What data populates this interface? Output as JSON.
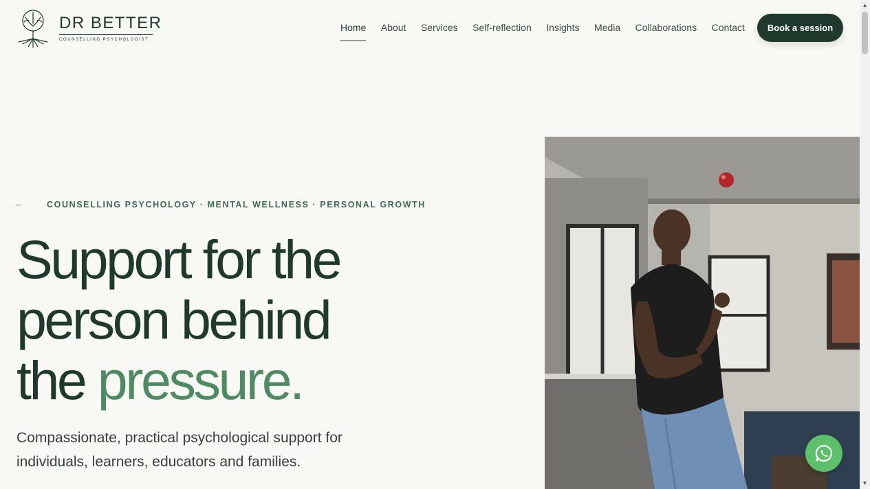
{
  "brand": {
    "name": "DR BETTER",
    "tagline": "COUNSELLING PSYCHOLOGIST",
    "icon": "tree-logo-icon"
  },
  "nav": {
    "items": [
      {
        "label": "Home",
        "active": true
      },
      {
        "label": "About"
      },
      {
        "label": "Services"
      },
      {
        "label": "Self-reflection"
      },
      {
        "label": "Insights"
      },
      {
        "label": "Media"
      },
      {
        "label": "Collaborations"
      },
      {
        "label": "Contact"
      }
    ],
    "cta_label": "Book a session"
  },
  "hero": {
    "eyebrow": "COUNSELLING PSYCHOLOGY · MENTAL WELLNESS · PERSONAL GROWTH",
    "headline_line1": "Support for the",
    "headline_line2": "person behind",
    "headline_line3_plain": "the ",
    "headline_line3_accent": "pressure.",
    "subtext": "Compassionate, practical psychological support for individuals, learners, educators and families."
  },
  "floating": {
    "whatsapp_icon": "whatsapp-icon"
  },
  "colors": {
    "primary": "#1f3a2c",
    "accent": "#4e8b63",
    "background": "#f8f8f4",
    "whatsapp": "#5cc06a"
  }
}
